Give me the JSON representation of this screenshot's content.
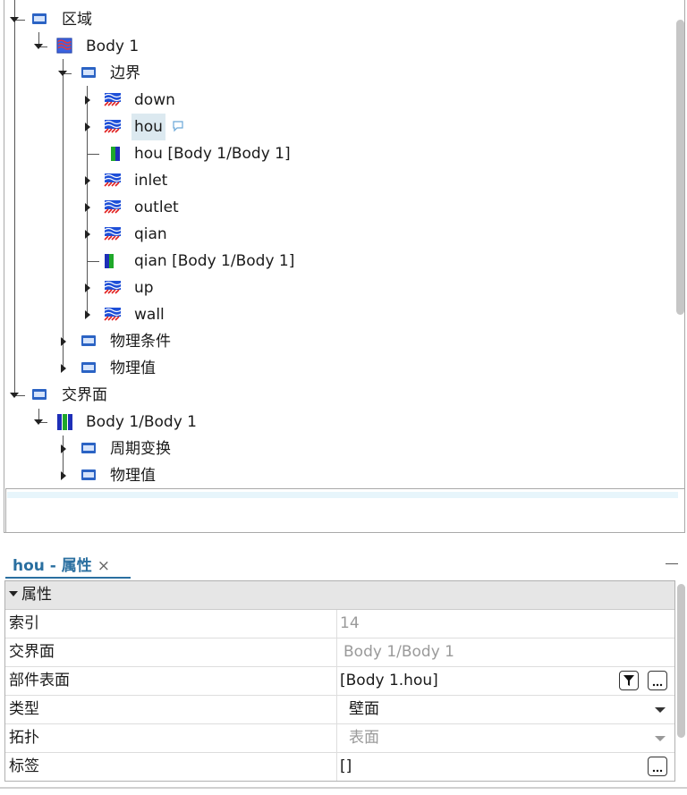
{
  "tree": {
    "nodes": {
      "region": "区域",
      "body1": "Body 1",
      "boundaries": "边界",
      "down": "down",
      "hou": "hou",
      "hou_if": "hou [Body 1/Body 1]",
      "inlet": "inlet",
      "outlet": "outlet",
      "qian": "qian",
      "qian_if": "qian [Body 1/Body 1]",
      "up": "up",
      "wall": "wall",
      "physics_conditions": "物理条件",
      "physics_values": "物理值",
      "interfaces": "交界面",
      "body1_body1": "Body 1/Body 1",
      "periodic_transform": "周期变换",
      "physics_values_2": "物理值"
    },
    "selected": "hou"
  },
  "properties": {
    "tab_title": "hou - 属性",
    "close": "×",
    "section": "属性",
    "rows": [
      {
        "key": "索引",
        "value": "14",
        "state": "disabled"
      },
      {
        "key": "交界面",
        "value": "Body 1/Body 1",
        "state": "disabled"
      },
      {
        "key": "部件表面",
        "value": "[Body 1.hou]",
        "state": "normal"
      },
      {
        "key": "类型",
        "value": "壁面",
        "state": "dropdown"
      },
      {
        "key": "拓扑",
        "value": "表面",
        "state": "dropdown-disabled"
      },
      {
        "key": "标签",
        "value": "[]",
        "state": "normal"
      }
    ]
  },
  "colors": {
    "accent": "#2a6fa0",
    "selection": "#dce9f0",
    "folder": "#2b63c4",
    "boundary_blue": "#1e4fd8",
    "boundary_red": "#e02020",
    "interface_green": "#1fa82a"
  }
}
